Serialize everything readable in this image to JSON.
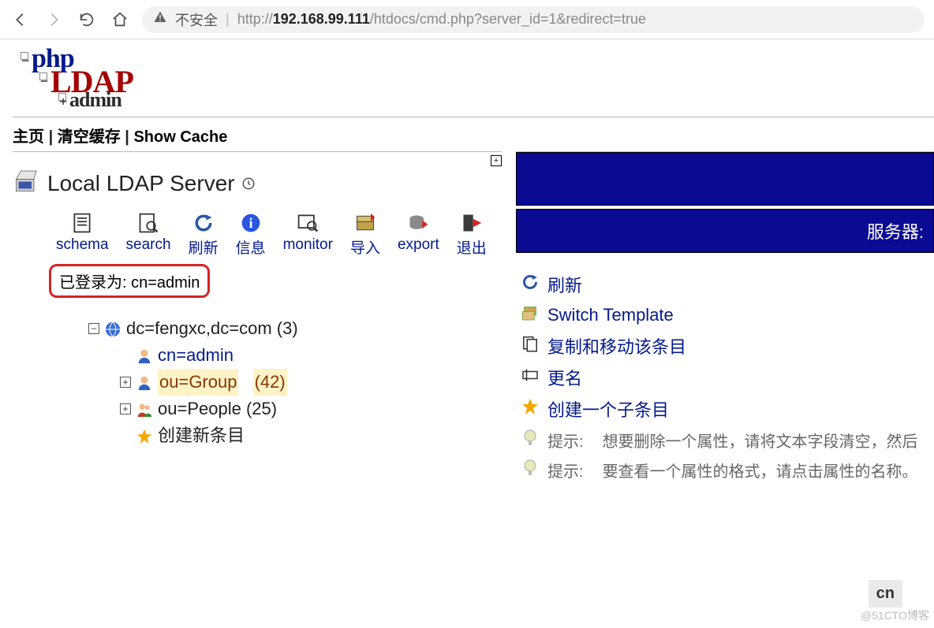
{
  "browser": {
    "not_secure": "不安全",
    "url_host": "192.168.99.111",
    "url_path": "/htdocs/cmd.php?server_id=1&redirect=true",
    "url_scheme": "http://"
  },
  "logo": {
    "l1": "php",
    "l2": "LDAP",
    "l3": "admin"
  },
  "topnav": {
    "home": "主页",
    "clear": "清空缓存",
    "show": "Show Cache",
    "sep": " | "
  },
  "server": {
    "title": "Local LDAP Server"
  },
  "tools": {
    "schema": "schema",
    "search": "search",
    "refresh": "刷新",
    "info": "信息",
    "monitor": "monitor",
    "import": "导入",
    "export": "export",
    "logout": "退出"
  },
  "login": {
    "prefix": "已登录为: ",
    "who": "cn=admin"
  },
  "tree": {
    "root": "dc=fengxc,dc=com",
    "root_count": "(3)",
    "admin": "cn=admin",
    "group": "ou=Group",
    "group_count": "(42)",
    "people": "ou=People",
    "people_count": "(25)",
    "new": "创建新条目"
  },
  "right": {
    "server_label": "服务器:",
    "actions": {
      "refresh": "刷新",
      "switch": "Switch Template",
      "copy": "复制和移动该条目",
      "rename": "更名",
      "create": "创建一个子条目"
    },
    "hints": {
      "label": "提示:",
      "h1": "想要删除一个属性，请将文本字段清空，然后",
      "h2": "要查看一个属性的格式，请点击属性的名称。"
    }
  },
  "cn_box": "cn",
  "watermark": "@51CTO博客"
}
